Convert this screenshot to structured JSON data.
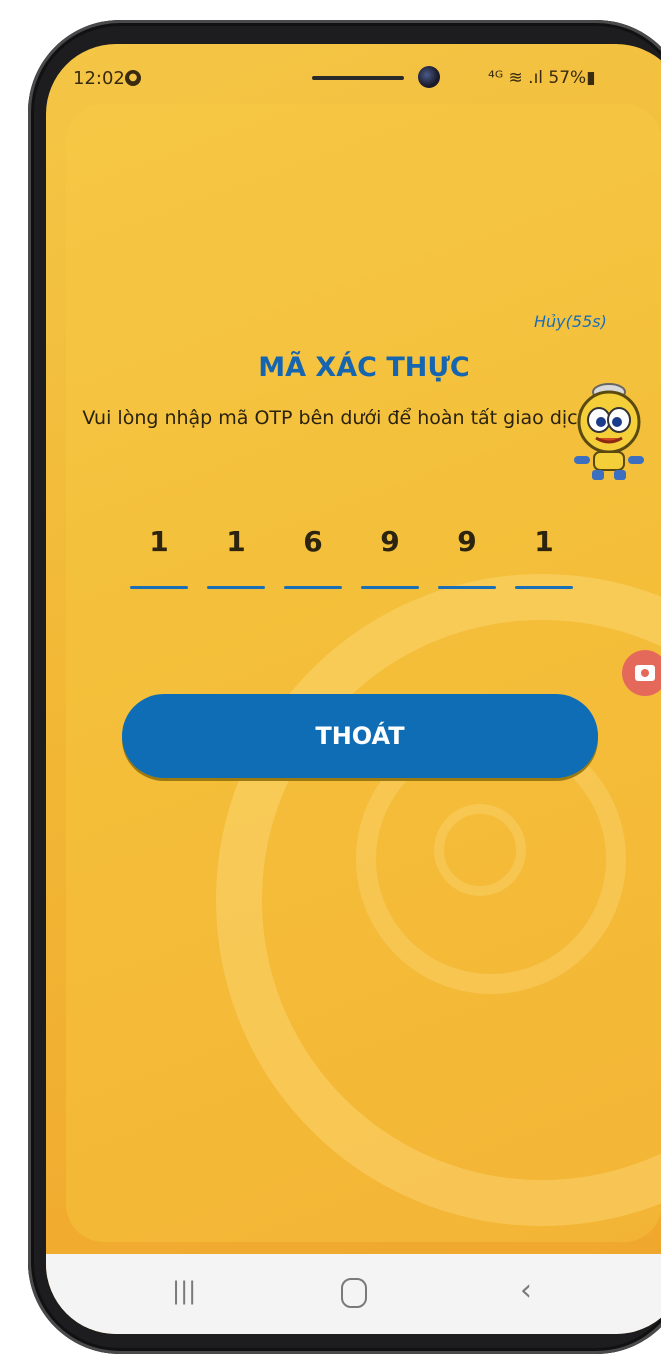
{
  "status_bar": {
    "time": "12:02",
    "notification_badge": "●",
    "right_indicators": "⁴ᴳ ≋ .ıl 57%▮",
    "battery": "57%"
  },
  "otp_screen": {
    "cancel_countdown": "Hủy(55s)",
    "title": "MÃ XÁC THỰC",
    "description": "Vui lòng nhập mã OTP bên dưới để hoàn tất giao dịch",
    "digits": [
      "1",
      "1",
      "6",
      "9",
      "9",
      "1"
    ],
    "exit_label": "THOÁT"
  },
  "nav_bar": {
    "recent_glyph": "|||",
    "back_glyph": "‹"
  },
  "colors": {
    "background_yellow": "#f2b735",
    "accent_blue": "#0e6db5",
    "record_red": "#e5695b"
  },
  "icons": {
    "mascot": "robot-mascot-icon",
    "record": "screen-record-icon",
    "home": "home-icon",
    "back": "back-icon",
    "recent": "recent-apps-icon"
  }
}
